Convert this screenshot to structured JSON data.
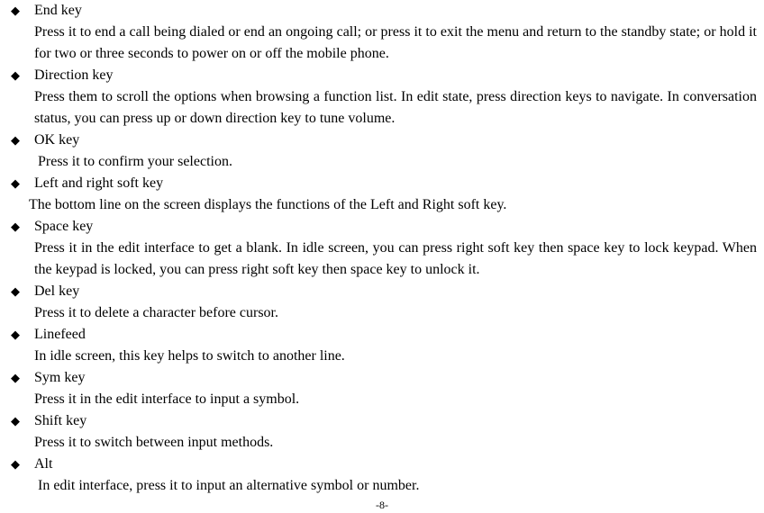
{
  "items": [
    {
      "title": "End key",
      "desc": "Press it to end a call being dialed or end an ongoing call; or press it to exit the menu and return to the standby state; or hold it for two or three seconds to power on or off the mobile phone.",
      "descClass": "desc"
    },
    {
      "title": "Direction key",
      "desc": "Press them to scroll the options when browsing a function list. In edit state, press direction keys to navigate. In conversation status, you can press up or down direction key to tune volume.",
      "descClass": "desc"
    },
    {
      "title": "OK key",
      "desc": "Press it to confirm your selection.",
      "descClass": "desc-indent"
    },
    {
      "title": "Left and right soft key",
      "desc": "The bottom line on the screen displays the functions of the Left and Right soft key.",
      "descClass": "desc-left"
    },
    {
      "title": "Space key",
      "desc": "Press it in the edit interface to get a blank. In idle screen, you can press right soft key then space key to lock keypad. When the keypad is locked, you can press right soft key then space key to unlock it.",
      "descClass": "desc"
    },
    {
      "title": "Del key",
      "desc": "Press it to delete a character before cursor.",
      "descClass": "desc"
    },
    {
      "title": "Linefeed",
      "desc": "In idle screen, this key helps to switch to another line.",
      "descClass": "desc"
    },
    {
      "title": "Sym key",
      "desc": "Press it in the edit interface to input a symbol.",
      "descClass": "desc"
    },
    {
      "title": "Shift key",
      "desc": "Press it to switch between input methods.",
      "descClass": "desc"
    },
    {
      "title": "Alt",
      "desc": "In edit interface, press it to input an alternative symbol or number.",
      "descClass": "desc-indent"
    }
  ],
  "pageNumber": "-8-"
}
